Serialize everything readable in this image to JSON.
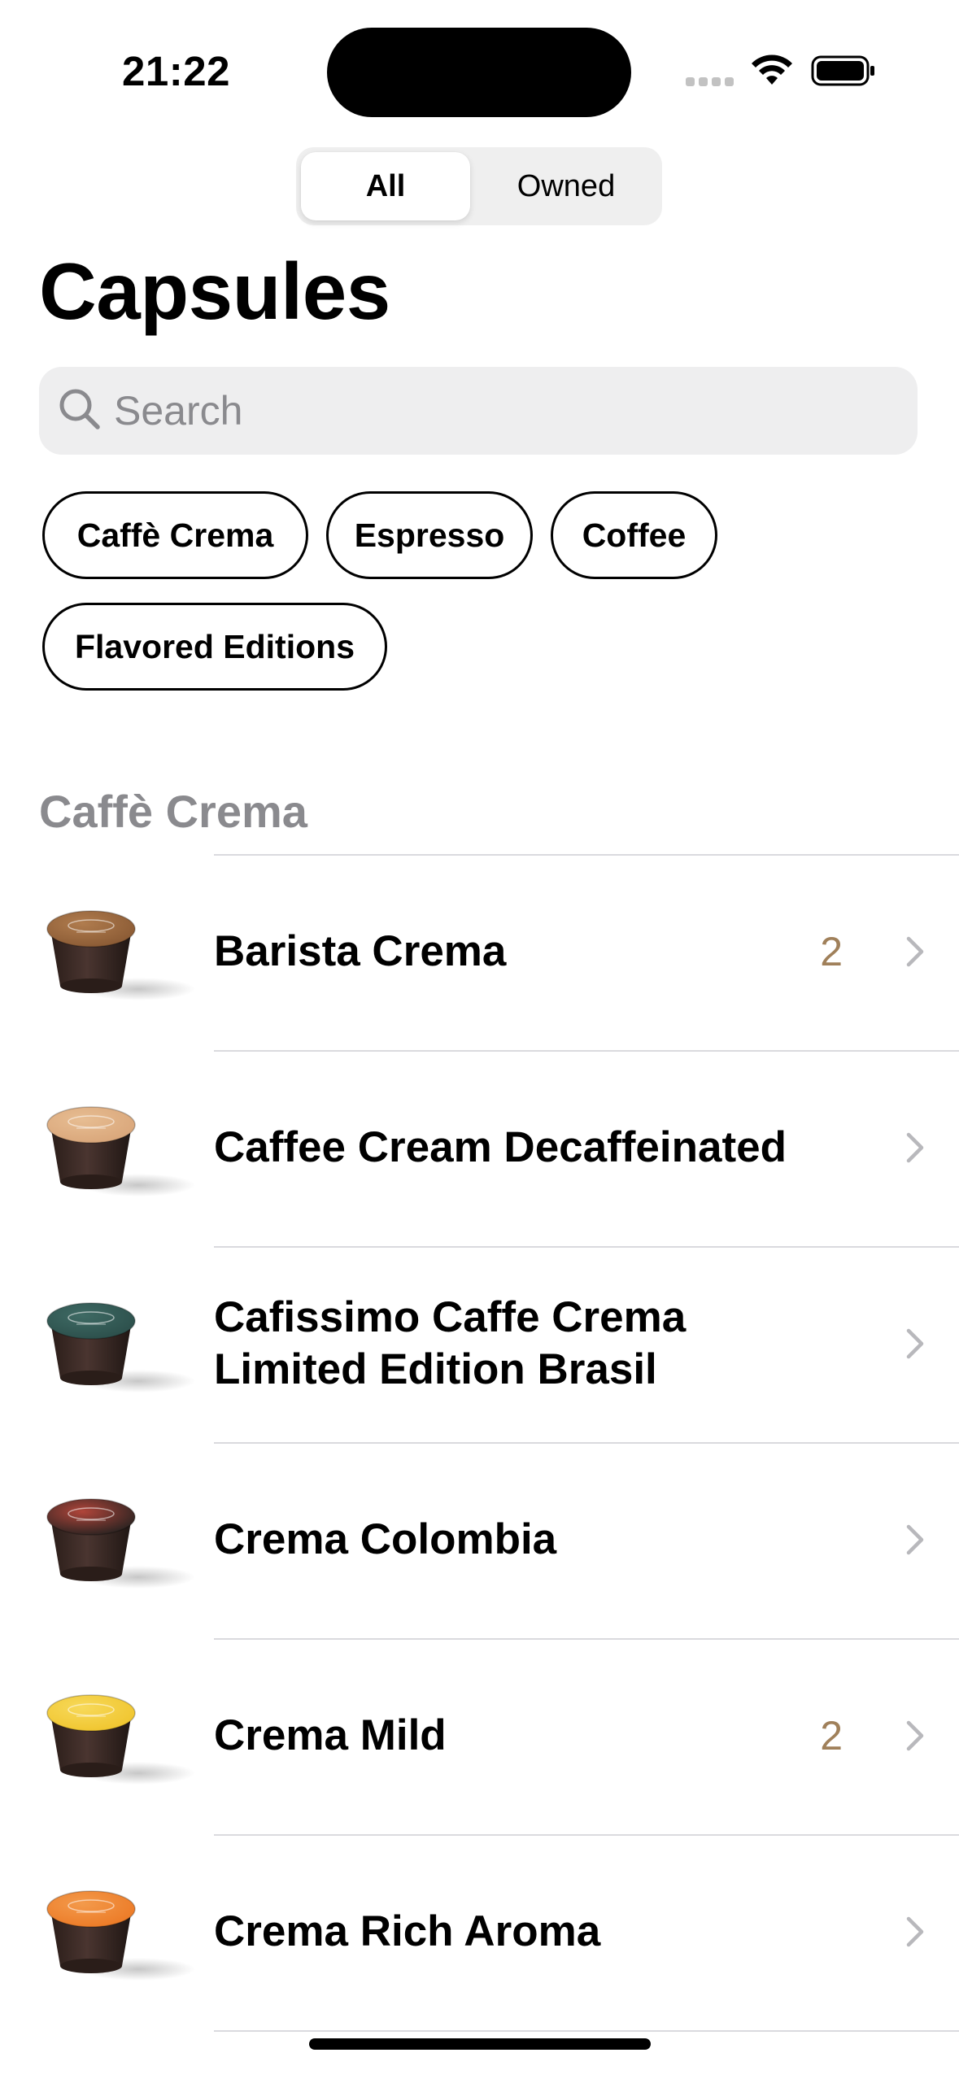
{
  "status_bar": {
    "time": "21:22"
  },
  "segmented": {
    "options": [
      "All",
      "Owned"
    ],
    "selected": "All"
  },
  "title": "Capsules",
  "search": {
    "placeholder": "Search",
    "value": ""
  },
  "filters": [
    "Caffè Crema",
    "Espresso",
    "Coffee",
    "Flavored Editions"
  ],
  "section": {
    "header": "Caffè Crema"
  },
  "items": [
    {
      "name": "Barista Crema",
      "count": "2",
      "lid_color": "#8a5a34",
      "lid_accent": "#b07c4e"
    },
    {
      "name": "Caffee Cream Decaffeinated",
      "count": "",
      "lid_color": "#d9a67a",
      "lid_accent": "#e7bd92"
    },
    {
      "name": "Cafissimo Caffe Crema Limited Edition Brasil",
      "count": "",
      "lid_color": "#2c4f4b",
      "lid_accent": "#3e6a64"
    },
    {
      "name": "Crema Colombia",
      "count": "",
      "lid_color": "#2a2321",
      "lid_accent": "#b0453a"
    },
    {
      "name": "Crema Mild",
      "count": "2",
      "lid_color": "#f0c52e",
      "lid_accent": "#f7d95a"
    },
    {
      "name": "Crema Rich Aroma",
      "count": "",
      "lid_color": "#ec7a26",
      "lid_accent": "#f39a4b"
    }
  ],
  "colors": {
    "accent_count": "#a0805a",
    "section_header": "#8a8a8e",
    "search_bg": "#eeeeef"
  },
  "icons": {
    "search": "magnifying-glass",
    "chevron": "chevron-right",
    "wifi": "wifi",
    "battery": "battery-full",
    "signal": "cellular-signal"
  }
}
